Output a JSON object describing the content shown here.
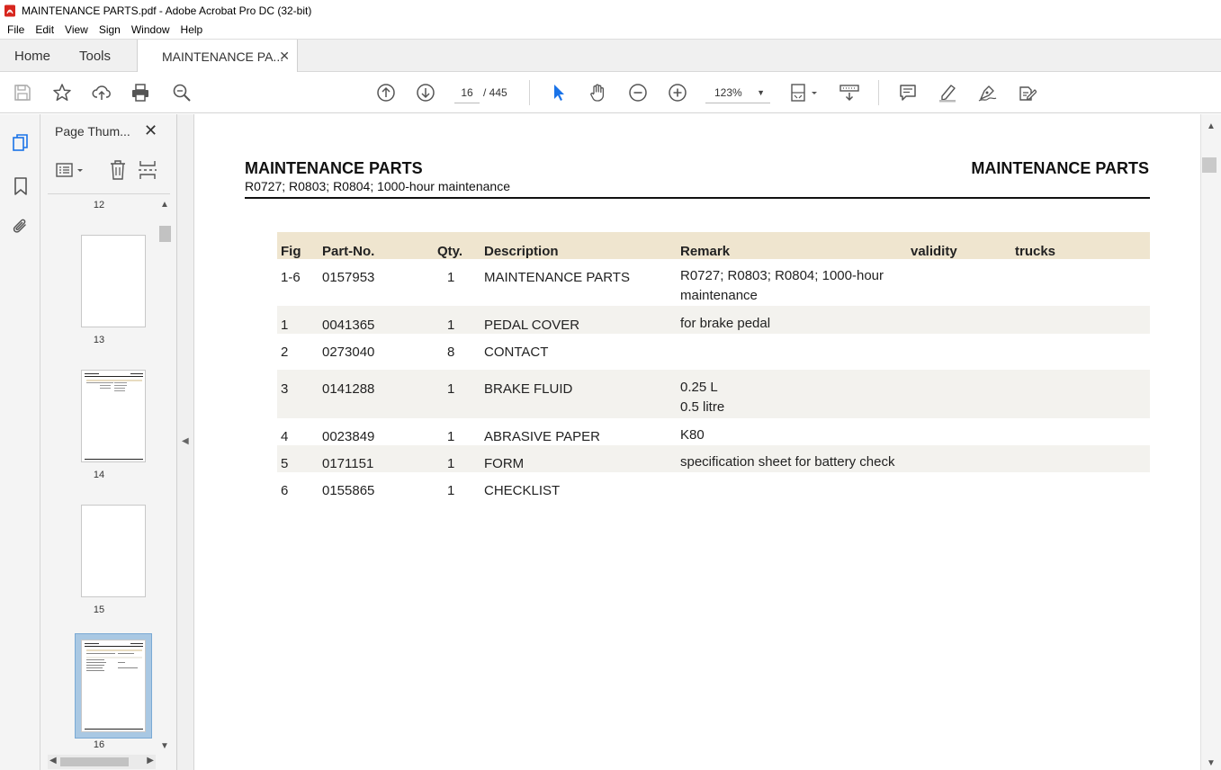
{
  "window": {
    "title": "MAINTENANCE PARTS.pdf - Adobe Acrobat Pro DC (32-bit)"
  },
  "menu": [
    "File",
    "Edit",
    "View",
    "Sign",
    "Window",
    "Help"
  ],
  "tabs": {
    "home": "Home",
    "tools": "Tools",
    "doc": "MAINTENANCE PA...",
    "close": "✕"
  },
  "toolbar": {
    "page_current": "16",
    "page_total": "/ 445",
    "zoom": "123%"
  },
  "thumbnails": {
    "title": "Page Thum...",
    "close": "✕",
    "pages": [
      "12",
      "13",
      "14",
      "15",
      "16"
    ],
    "selected": "16"
  },
  "document": {
    "title_left": "MAINTENANCE PARTS",
    "title_right": "MAINTENANCE PARTS",
    "subtitle": "R0727; R0803; R0804; 1000-hour maintenance",
    "table": {
      "headers": [
        "Fig",
        "Part-No.",
        "Qty.",
        "Description",
        "Remark",
        "validity",
        "trucks"
      ],
      "rows": [
        {
          "fig": "1-6",
          "part": "0157953",
          "qty": "1",
          "desc": "MAINTENANCE PARTS",
          "remark1": "R0727; R0803; R0804; 1000-hour",
          "remark2": "maintenance"
        },
        {
          "fig": "1",
          "part": "0041365",
          "qty": "1",
          "desc": "PEDAL COVER",
          "remark1": "for brake pedal",
          "remark2": ""
        },
        {
          "fig": "2",
          "part": "0273040",
          "qty": "8",
          "desc": "CONTACT",
          "remark1": "",
          "remark2": ""
        },
        {
          "fig": "3",
          "part": "0141288",
          "qty": "1",
          "desc": "BRAKE FLUID",
          "remark1": "0.25 L",
          "remark2": "0.5 litre"
        },
        {
          "fig": "4",
          "part": "0023849",
          "qty": "1",
          "desc": "ABRASIVE PAPER",
          "remark1": "K80",
          "remark2": ""
        },
        {
          "fig": "5",
          "part": "0171151",
          "qty": "1",
          "desc": "FORM",
          "remark1": "specification sheet for battery check",
          "remark2": ""
        },
        {
          "fig": "6",
          "part": "0155865",
          "qty": "1",
          "desc": "CHECKLIST",
          "remark1": "",
          "remark2": ""
        }
      ]
    }
  },
  "colors": {
    "table_header": "#efe5cf",
    "alt_row": "#f3f2ee",
    "selection": "#a9c8e3",
    "select_tool": "#1a73e8",
    "acrobat_red": "#d7261e"
  }
}
